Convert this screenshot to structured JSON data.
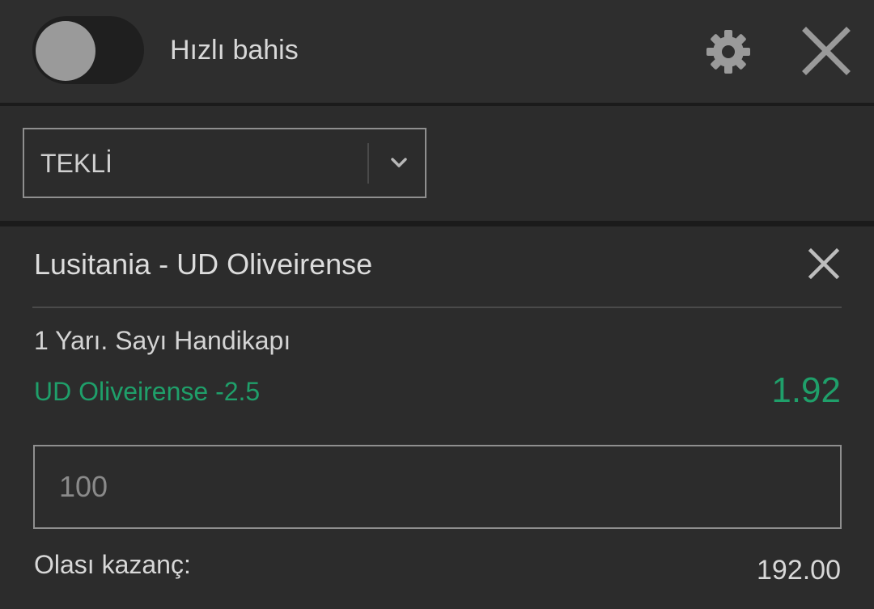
{
  "header": {
    "quick_bet_label": "Hızlı bahis",
    "quick_bet_toggle_on": false,
    "settings_icon": "gear-icon",
    "close_icon": "close-icon"
  },
  "bet_type": {
    "selected": "TEKLİ",
    "dropdown_icon": "chevron-down-icon"
  },
  "bet": {
    "match": "Lusitania - UD Oliveirense",
    "market": "1 Yarı. Sayı Handikapı",
    "selection": "UD Oliveirense -2.5",
    "odds": "1.92",
    "stake": "100",
    "potential_win_label": "Olası kazanç:",
    "potential_win_value": "192.00"
  },
  "colors": {
    "accent_green": "#1f9f6a",
    "background": "#2c2c2c",
    "divider": "#1b1b1b"
  }
}
